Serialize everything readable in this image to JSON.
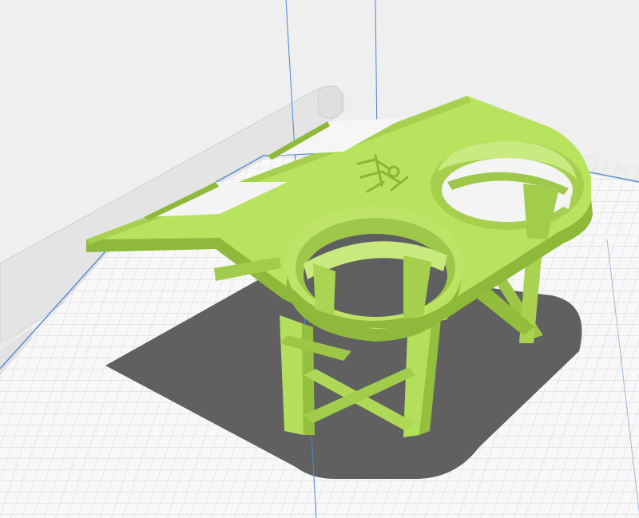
{
  "viewport": {
    "colors": {
      "background": "#f2f2f2",
      "build_plate": "#f7f7f7",
      "grid_line": "#cfcfcf",
      "plate_border": "#4a86c8",
      "model": "#b6e05c",
      "model_dark": "#93bd3d",
      "model_light": "#c9ea7a",
      "shadow": "#5e5e5e",
      "axis_line": "#3a7fd0"
    },
    "model": {
      "kind": "dual cup holder tray",
      "emboss_icon": "logo-emboss-icon"
    }
  }
}
